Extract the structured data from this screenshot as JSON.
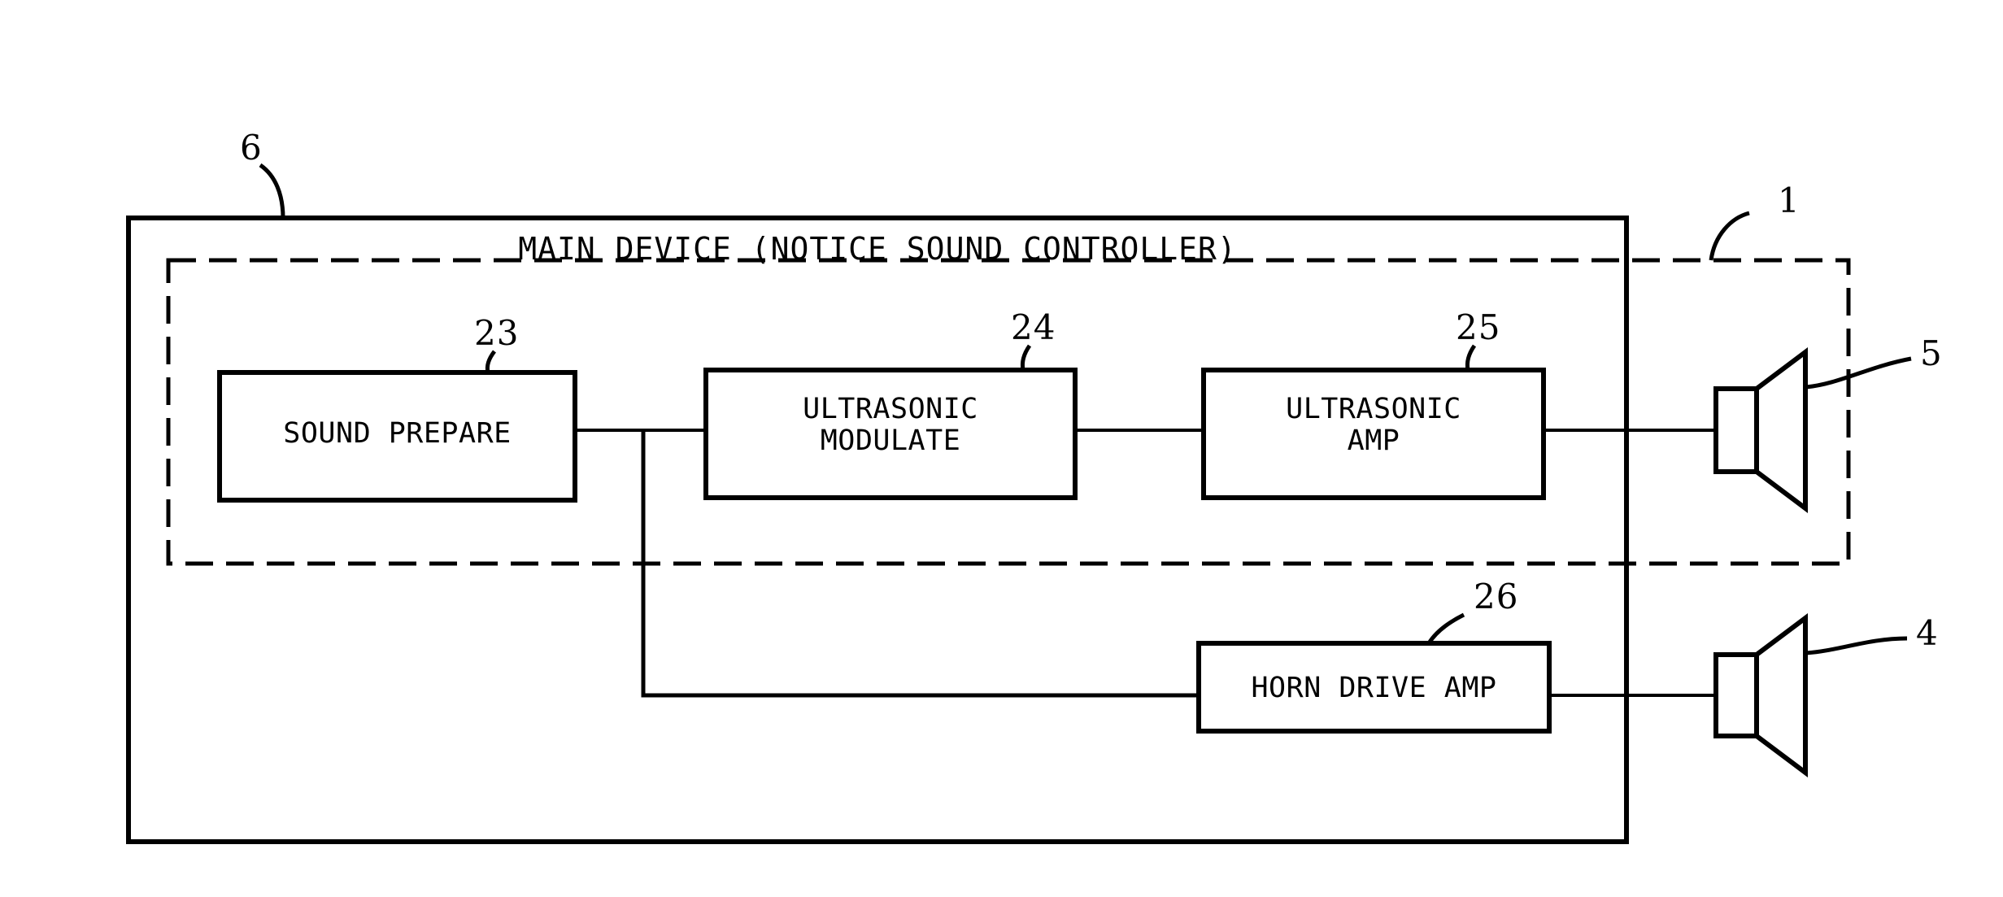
{
  "figure": {
    "kind": "patent-block-diagram",
    "title": "MAIN DEVICE (NOTICE SOUND CONTROLLER)",
    "stroke_color": "#000000",
    "background_color": "#ffffff"
  },
  "enclosures": {
    "outer_box": {
      "name": "main-device-enclosure",
      "style": "solid",
      "reference_numeral": "6"
    },
    "inner_box": {
      "name": "ultrasonic-subsystem-enclosure",
      "style": "dashed",
      "reference_numeral": "1"
    }
  },
  "blocks": [
    {
      "id": "sound-prepare",
      "label": "SOUND PREPARE",
      "lines": [
        "SOUND PREPARE"
      ],
      "reference_numeral": "23"
    },
    {
      "id": "ultrasonic-modulate",
      "label": "ULTRASONIC MODULATE",
      "lines": [
        "ULTRASONIC",
        "MODULATE"
      ],
      "reference_numeral": "24"
    },
    {
      "id": "ultrasonic-amp",
      "label": "ULTRASONIC AMP",
      "lines": [
        "ULTRASONIC",
        "AMP"
      ],
      "reference_numeral": "25"
    },
    {
      "id": "horn-drive-amp",
      "label": "HORN DRIVE AMP",
      "lines": [
        "HORN DRIVE AMP"
      ],
      "reference_numeral": "26"
    }
  ],
  "speakers": [
    {
      "id": "ultrasonic-speaker",
      "icon": "speaker-icon",
      "reference_numeral": "5"
    },
    {
      "id": "horn-speaker",
      "icon": "speaker-icon",
      "reference_numeral": "4"
    }
  ],
  "reference_numerals": {
    "outer_enclosure": "6",
    "inner_enclosure": "1",
    "sound_prepare": "23",
    "ultrasonic_modulate": "24",
    "ultrasonic_amp": "25",
    "horn_drive_amp": "26",
    "ultrasonic_speaker": "5",
    "horn_speaker": "4"
  },
  "connections": [
    {
      "from": "sound-prepare",
      "to": "ultrasonic-modulate"
    },
    {
      "from": "sound-prepare",
      "to": "horn-drive-amp"
    },
    {
      "from": "ultrasonic-modulate",
      "to": "ultrasonic-amp"
    },
    {
      "from": "ultrasonic-amp",
      "to": "ultrasonic-speaker"
    },
    {
      "from": "horn-drive-amp",
      "to": "horn-speaker"
    }
  ]
}
